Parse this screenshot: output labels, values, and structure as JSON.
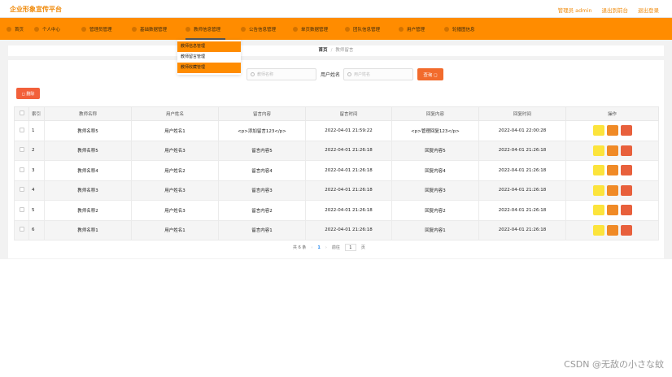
{
  "app": {
    "title": "企业形象宣传平台"
  },
  "header_links": [
    "管理员 admin",
    "退出到前台",
    "退出登录"
  ],
  "nav": [
    {
      "label": "首页"
    },
    {
      "label": "个人中心"
    },
    {
      "label": "管理员管理"
    },
    {
      "label": "基础数据管理"
    },
    {
      "label": "教师信息管理"
    },
    {
      "label": "公告信息管理"
    },
    {
      "label": "单页数据管理"
    },
    {
      "label": "团队信息管理"
    },
    {
      "label": "用户管理"
    },
    {
      "label": "轮播图信息"
    }
  ],
  "dropdown": [
    "教师信息管理",
    "教师留言管理",
    "教师收藏管理"
  ],
  "breadcrumb": {
    "home": "首页",
    "separator": "/",
    "current": "教师留言"
  },
  "search": {
    "field1_placeholder": "教师名称",
    "field2_label": "用户姓名",
    "field2_placeholder": "用户姓名",
    "query_label": "查询 ◻"
  },
  "delete_label": "◻ 删除",
  "table": {
    "headers": [
      "索引",
      "教师名称",
      "用户姓名",
      "留言内容",
      "留言时间",
      "回复内容",
      "回复时间",
      "操作"
    ],
    "rows": [
      [
        "1",
        "教师名称5",
        "用户姓名1",
        "<p>添加留言123</p>",
        "2022-04-01 21:59:22",
        "<p>管理回复123</p>",
        "2022-04-01 22:00:28"
      ],
      [
        "2",
        "教师名称5",
        "用户姓名3",
        "留言内容5",
        "2022-04-01 21:26:18",
        "回复内容5",
        "2022-04-01 21:26:18"
      ],
      [
        "3",
        "教师名称4",
        "用户姓名2",
        "留言内容4",
        "2022-04-01 21:26:18",
        "回复内容4",
        "2022-04-01 21:26:18"
      ],
      [
        "4",
        "教师名称3",
        "用户姓名3",
        "留言内容3",
        "2022-04-01 21:26:18",
        "回复内容3",
        "2022-04-01 21:26:18"
      ],
      [
        "5",
        "教师名称2",
        "用户姓名3",
        "留言内容2",
        "2022-04-01 21:26:18",
        "回复内容2",
        "2022-04-01 21:26:18"
      ],
      [
        "6",
        "教师名称1",
        "用户姓名1",
        "留言内容1",
        "2022-04-01 21:26:18",
        "回复内容1",
        "2022-04-01 21:26:18"
      ]
    ]
  },
  "pager": {
    "total": "共 6 条",
    "prev": "‹",
    "page": "1",
    "next": "›",
    "goto_label": "前往",
    "goto_value": "1",
    "page_unit": "页"
  },
  "watermark": "CSDN @无敌の小さな蚊",
  "colors": {
    "accent": "#ff8c00",
    "brand_text": "#f08a0a",
    "query": "#f26b2c",
    "delete": "#f2603a",
    "op_yellow": "#fce43c",
    "op_orange": "#f08a26",
    "op_red": "#e8603c"
  }
}
